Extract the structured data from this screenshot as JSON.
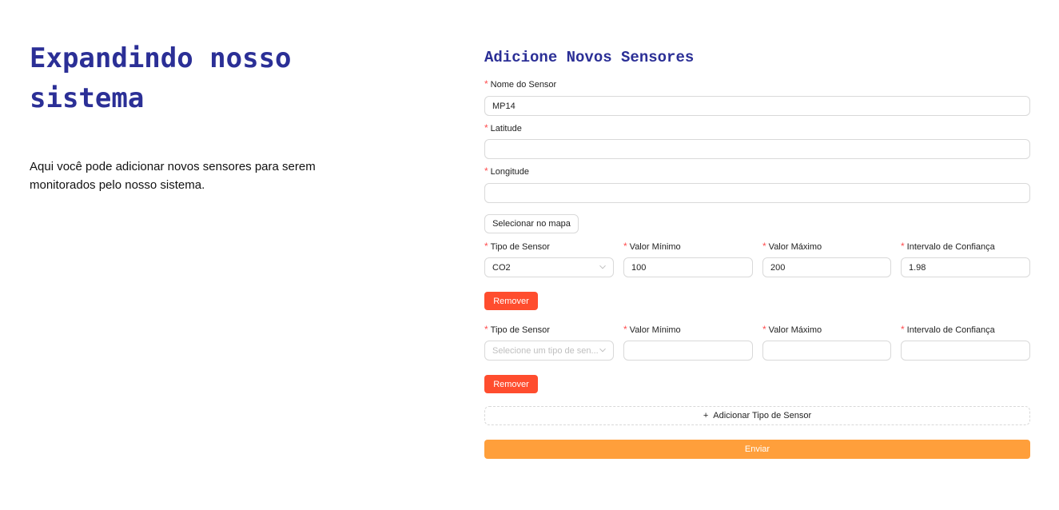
{
  "hero": {
    "title": "Expandindo nosso sistema",
    "description": "Aqui você pode adicionar novos sensores para serem monitorados pelo nosso sistema."
  },
  "form": {
    "title": "Adicione Novos Sensores",
    "required_mark": "*",
    "sensor_name": {
      "label": "Nome do Sensor",
      "value": "MP14"
    },
    "latitude": {
      "label": "Latitude",
      "value": ""
    },
    "longitude": {
      "label": "Longitude",
      "value": ""
    },
    "select_on_map_button": "Selecionar no mapa",
    "sensor_types": [
      {
        "type_label": "Tipo de Sensor",
        "type_value": "CO2",
        "min_label": "Valor Mínimo",
        "min_value": "100",
        "max_label": "Valor Máximo",
        "max_value": "200",
        "confidence_label": "Intervalo de Confiança",
        "confidence_value": "1.98",
        "remove_button": "Remover"
      },
      {
        "type_label": "Tipo de Sensor",
        "type_placeholder": "Selecione um tipo de sen...",
        "min_label": "Valor Mínimo",
        "min_value": "",
        "max_label": "Valor Máximo",
        "max_value": "",
        "confidence_label": "Intervalo de Confiança",
        "confidence_value": "",
        "remove_button": "Remover"
      }
    ],
    "add_type_button": {
      "icon": "plus-icon",
      "glyph": "+",
      "label": "Adicionar Tipo de Sensor"
    },
    "submit_button": "Enviar"
  },
  "colors": {
    "title": "#2b2f96",
    "danger": "#ff4d2e",
    "primary": "#ff9f3b",
    "required": "#ff4d4f"
  }
}
